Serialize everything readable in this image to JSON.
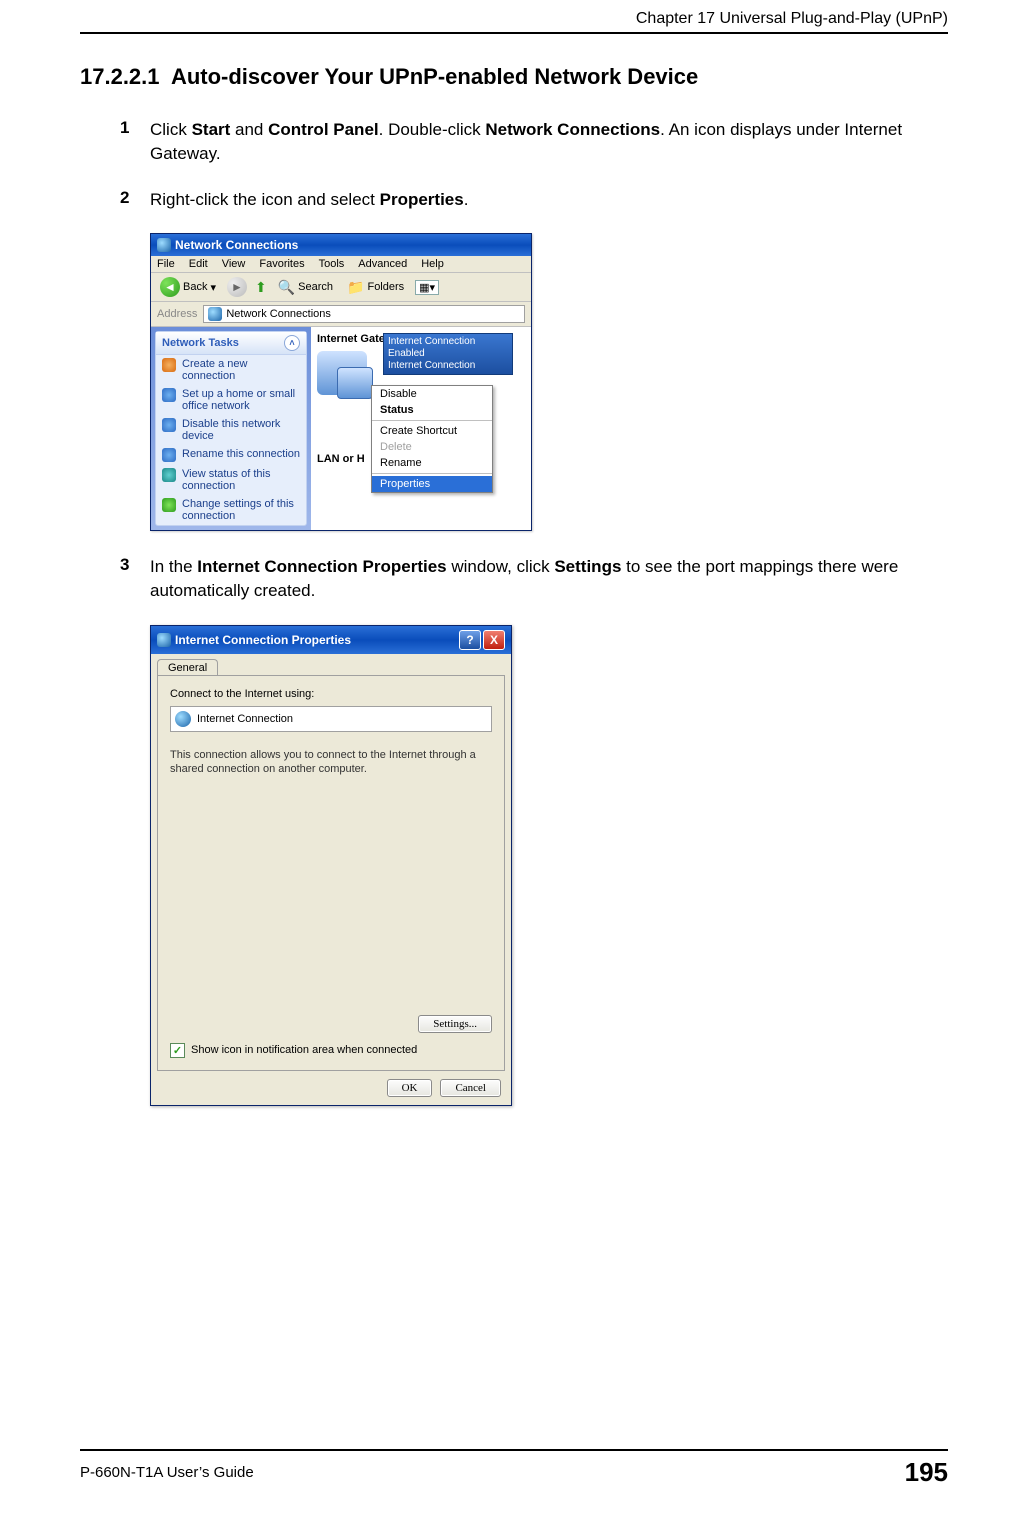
{
  "header": {
    "chapter": "Chapter 17 Universal Plug-and-Play (UPnP)"
  },
  "section": {
    "number": "17.2.2.1",
    "title": "Auto-discover Your UPnP-enabled Network Device"
  },
  "steps": {
    "s1": {
      "num": "1",
      "a": "Click ",
      "b1": "Start",
      "c": " and ",
      "b2": "Control Panel",
      "d": ". Double-click ",
      "b3": "Network Connections",
      "e": ". An icon displays under Internet Gateway."
    },
    "s2": {
      "num": "2",
      "a": "Right-click the icon and select ",
      "b1": "Properties",
      "c": "."
    },
    "s3": {
      "num": "3",
      "a": "In the ",
      "b1": "Internet Connection Properties",
      "c": " window, click ",
      "b2": "Settings",
      "d": " to see the port mappings there were automatically created."
    }
  },
  "nc": {
    "title": "Network Connections",
    "menu": {
      "file": "File",
      "edit": "Edit",
      "view": "View",
      "favorites": "Favorites",
      "tools": "Tools",
      "advanced": "Advanced",
      "help": "Help"
    },
    "toolbar": {
      "back": "Back",
      "search": "Search",
      "folders": "Folders"
    },
    "address": {
      "label": "Address",
      "value": "Network Connections"
    },
    "side": {
      "head": "Network Tasks",
      "t1": "Create a new connection",
      "t2": "Set up a home or small office network",
      "t3": "Disable this network device",
      "t4": "Rename this connection",
      "t5": "View status of this connection",
      "t6": "Change settings of this connection"
    },
    "main": {
      "section1": "Internet Gateway",
      "tooltip_l1": "Internet Connection",
      "tooltip_l2": "Enabled",
      "tooltip_l3": "Internet Connection",
      "lan": "LAN or H"
    },
    "ctx": {
      "disable": "Disable",
      "status": "Status",
      "shortcut": "Create Shortcut",
      "delete": "Delete",
      "rename": "Rename",
      "properties": "Properties"
    }
  },
  "pr": {
    "title": "Internet Connection Properties",
    "tab": "General",
    "label": "Connect to the Internet using:",
    "conn_name": "Internet Connection",
    "desc": "This connection allows you to connect to the Internet through a shared connection on another computer.",
    "settings_btn": "Settings...",
    "checkbox": "Show icon in notification area when connected",
    "ok": "OK",
    "cancel": "Cancel",
    "help": "?",
    "close": "X"
  },
  "footer": {
    "guide": "P-660N-T1A User’s Guide",
    "page": "195"
  }
}
